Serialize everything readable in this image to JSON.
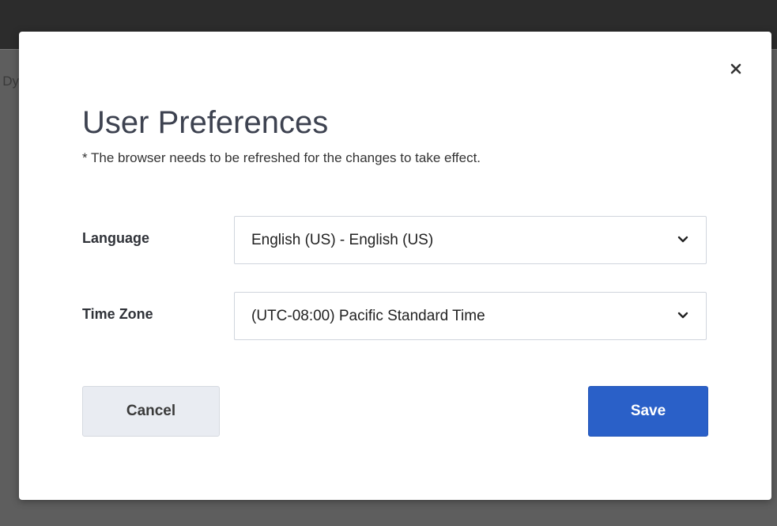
{
  "background": {
    "peek_text": "Dy"
  },
  "dialog": {
    "title": "User Preferences",
    "subtitle": "* The browser needs to be refreshed for the changes to take effect.",
    "close_icon": "close-icon",
    "fields": {
      "language": {
        "label": "Language",
        "value": "English (US) - English (US)",
        "icon": "chevron-down-icon"
      },
      "time_zone": {
        "label": "Time Zone",
        "value": "(UTC-08:00) Pacific Standard Time",
        "icon": "chevron-down-icon"
      }
    },
    "buttons": {
      "cancel": "Cancel",
      "save": "Save"
    }
  },
  "colors": {
    "overlay": "#5e5e5e",
    "topbar": "#2c2c2c",
    "primary": "#2a60c8",
    "secondary_button": "#e9ecf2",
    "title_text": "#3d4250"
  }
}
